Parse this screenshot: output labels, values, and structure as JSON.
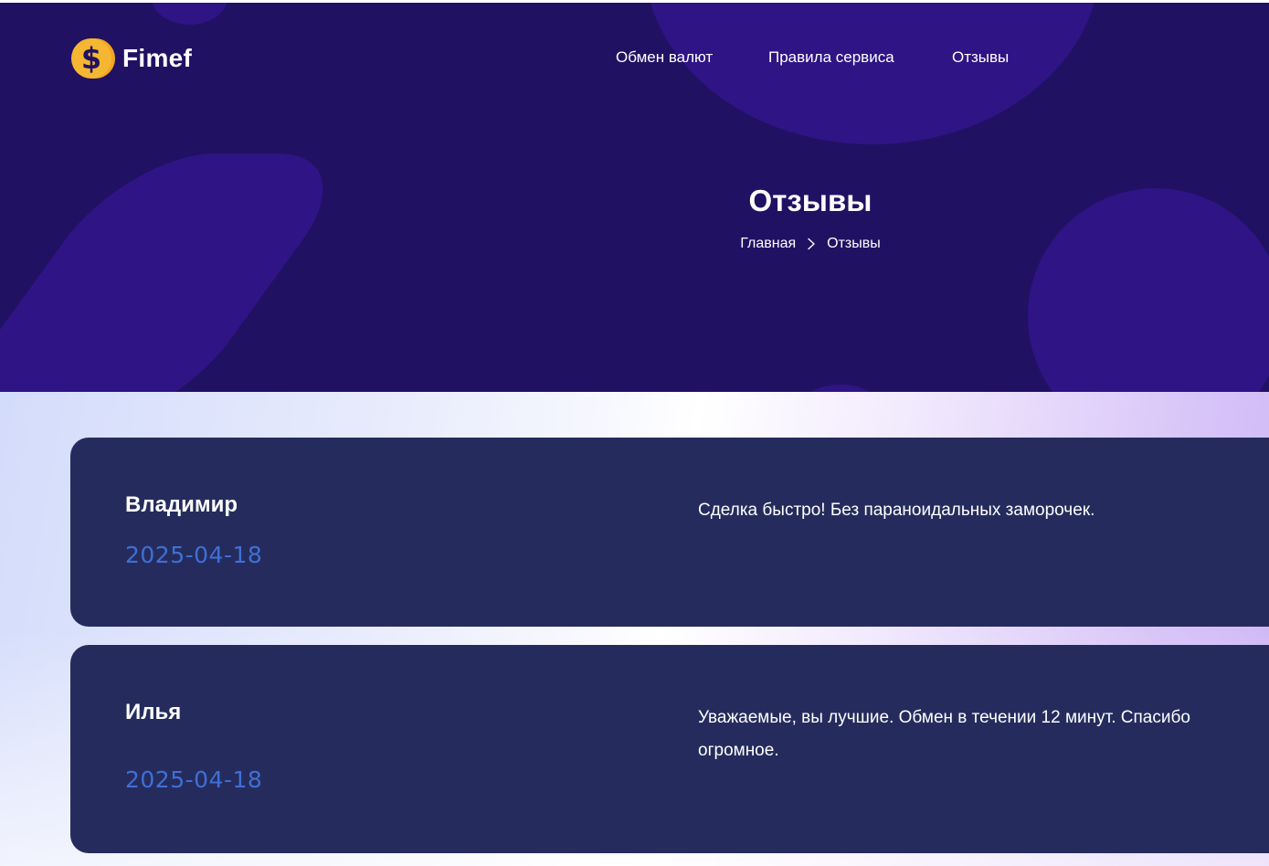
{
  "brand": {
    "name": "Fimef",
    "icon": "dollar-coin-icon",
    "accent": "#f5b731"
  },
  "nav": {
    "items": [
      {
        "label": "Обмен валют"
      },
      {
        "label": "Правила сервиса"
      },
      {
        "label": "Отзывы"
      }
    ]
  },
  "hero": {
    "title": "Отзывы",
    "breadcrumb": {
      "home": "Главная",
      "separator_icon": "chevron-right-icon",
      "current": "Отзывы"
    }
  },
  "reviews": [
    {
      "author": "Владимир",
      "date": "2025-04-18",
      "text": "Сделка быстро! Без параноидальных заморочек."
    },
    {
      "author": "Илья",
      "date": "2025-04-18",
      "text": "Уважаемые, вы лучшие. Обмен в течении 12 минут. Спасибо огромное."
    }
  ],
  "colors": {
    "hero_bg": "#211163",
    "hero_shapes": "#2e1485",
    "card_bg": "#252c5d",
    "date_color": "#3f6fd6"
  }
}
